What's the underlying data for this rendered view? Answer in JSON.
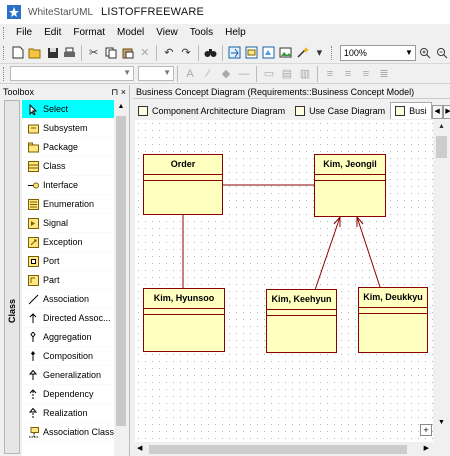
{
  "window": {
    "app_name": "WhiteStarUML",
    "brand": "LISTOFFREEWARE"
  },
  "menu": [
    "File",
    "Edit",
    "Format",
    "Model",
    "View",
    "Tools",
    "Help"
  ],
  "toolbar": {
    "zoom": "100%",
    "zoom_in_icon": "zoom-in-icon",
    "zoom_out_icon": "zoom-out-icon"
  },
  "toolbox": {
    "title": "Toolbox",
    "pin": "⊓",
    "close": "×",
    "section": "Class",
    "items": [
      {
        "label": "Select",
        "icon": "arrow-cursor-icon"
      },
      {
        "label": "Subsystem",
        "icon": "subsystem-icon"
      },
      {
        "label": "Package",
        "icon": "package-icon"
      },
      {
        "label": "Class",
        "icon": "class-icon"
      },
      {
        "label": "Interface",
        "icon": "interface-icon"
      },
      {
        "label": "Enumeration",
        "icon": "enumeration-icon"
      },
      {
        "label": "Signal",
        "icon": "signal-icon"
      },
      {
        "label": "Exception",
        "icon": "exception-icon"
      },
      {
        "label": "Port",
        "icon": "port-icon"
      },
      {
        "label": "Part",
        "icon": "part-icon"
      },
      {
        "label": "Association",
        "icon": "association-icon"
      },
      {
        "label": "Directed Assoc...",
        "icon": "directed-association-icon"
      },
      {
        "label": "Aggregation",
        "icon": "aggregation-icon"
      },
      {
        "label": "Composition",
        "icon": "composition-icon"
      },
      {
        "label": "Generalization",
        "icon": "generalization-icon"
      },
      {
        "label": "Dependency",
        "icon": "dependency-icon"
      },
      {
        "label": "Realization",
        "icon": "realization-icon"
      },
      {
        "label": "Association Class",
        "icon": "association-class-icon"
      }
    ]
  },
  "diagram": {
    "title": "Business Concept Diagram (Requirements::Business Concept Model)",
    "tabs": [
      {
        "label": "Component Architecture Diagram",
        "active": false
      },
      {
        "label": "Use Case Diagram",
        "active": false
      },
      {
        "label": "Busi",
        "active": true
      }
    ],
    "classes": [
      "Order",
      "Kim, Jeongil",
      "Kim, Hyunsoo",
      "Kim, Keehyun",
      "Kim, Deukkyu"
    ],
    "line_color": "#8b0000",
    "fill_color": "#ffffc0"
  }
}
